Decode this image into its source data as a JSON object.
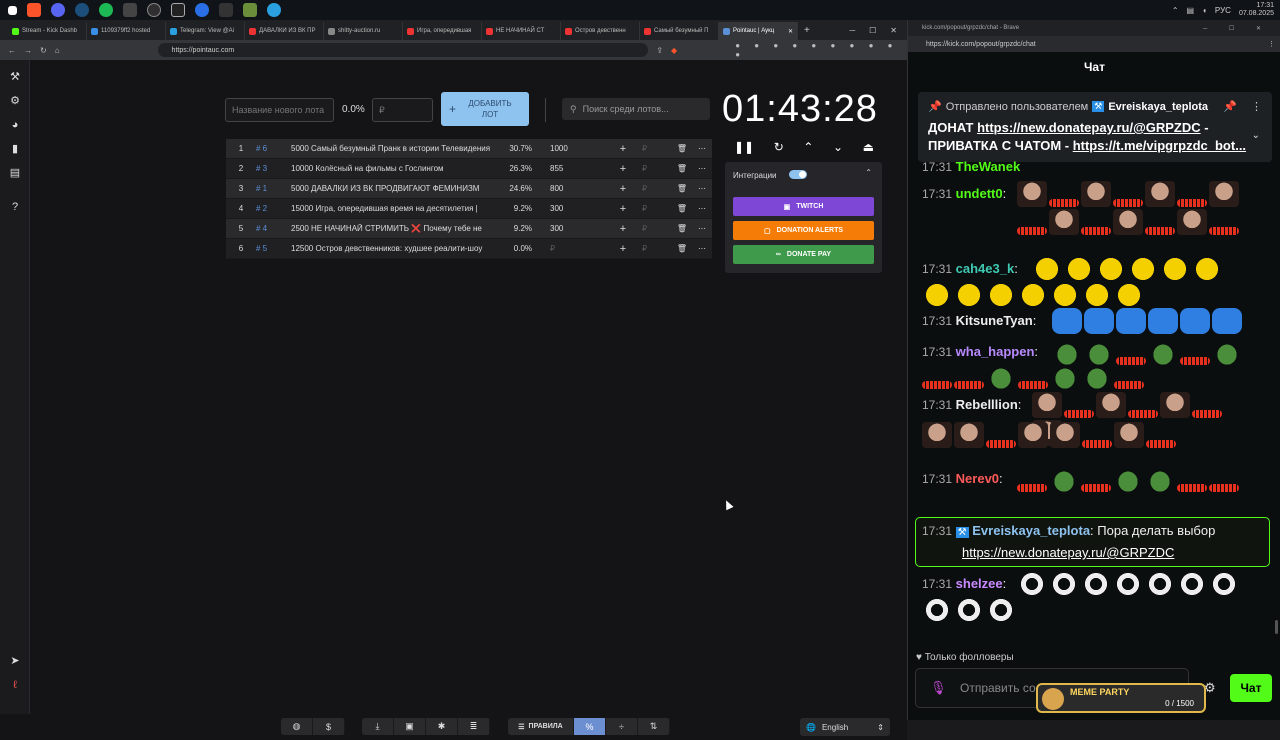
{
  "taskbar": {
    "lang": "РУС",
    "time": "17:31",
    "date": "07.08.2025"
  },
  "left_browser": {
    "tabs": [
      {
        "label": "Stream - Kick Dashb",
        "color": "#53fc18"
      },
      {
        "label": "1109379ff2 hosted",
        "color": "#3a8ee6"
      },
      {
        "label": "Telegram: View @Ai",
        "color": "#2aa0e0"
      },
      {
        "label": "ДАВАЛКИ ИЗ ВК ПР",
        "color": "#e33"
      },
      {
        "label": "shitty-auction.ru",
        "color": "#888"
      },
      {
        "label": "Игра, опередившая",
        "color": "#e33"
      },
      {
        "label": "НЕ НАЧИНАЙ СТ",
        "color": "#e33"
      },
      {
        "label": "Остров девственн",
        "color": "#e33"
      },
      {
        "label": "Самый безумный П",
        "color": "#e33"
      },
      {
        "label": "Pointauc | Аукц",
        "color": "#5b8fd6"
      }
    ],
    "url": "https://pointauc.com"
  },
  "app": {
    "new_lot_placeholder": "Название нового лота",
    "percent": "0.0%",
    "amount_placeholder": "₽",
    "add_lot_label": "ДОБАВИТЬ ЛОТ",
    "search_placeholder": "Поиск среди лотов...",
    "timer": "01:43:28",
    "lots": [
      {
        "n": "1",
        "id": "# 6",
        "name": "5000 Самый безумный Пранк в истории Телевидения",
        "pct": "30.7%",
        "amount": "1000"
      },
      {
        "n": "2",
        "id": "# 3",
        "name": "10000 Колёсный на фильмы с Гослингом",
        "pct": "26.3%",
        "amount": "855"
      },
      {
        "n": "3",
        "id": "# 1",
        "name": "5000 ДАВАЛКИ ИЗ ВК ПРОДВИГАЮТ ФЕМИНИЗМ",
        "pct": "24.6%",
        "amount": "800"
      },
      {
        "n": "4",
        "id": "# 2",
        "name": "15000 Игра, опередившая время на десятилетия |",
        "pct": "9.2%",
        "amount": "300"
      },
      {
        "n": "5",
        "id": "# 4",
        "name": "2500 НЕ НАЧИНАЙ СТРИМИТЬ ❌ Почему тебе не",
        "pct": "9.2%",
        "amount": "300"
      },
      {
        "n": "6",
        "id": "# 5",
        "name": "12500 Остров девственников: худшее реалити-шоу",
        "pct": "0.0%",
        "amount": ""
      }
    ],
    "row_currency": "₽",
    "integrations": {
      "label": "Интеграции",
      "twitch": "TWITCH",
      "donation_alerts": "DONATION ALERTS",
      "donate_pay": "DONATE PAY"
    },
    "bottom": {
      "rules": "ПРАВИЛА",
      "language": "English"
    }
  },
  "right_browser": {
    "title": "kick.com/popout/grpzdc/chat - Brave",
    "url": "https://kick.com/popout/grpzdc/chat",
    "chat_title": "Чат",
    "pinned": {
      "prefix": "Отправлено пользователем",
      "user": "Evreiskaya_teplota",
      "line1_text": "ДОНАТ ",
      "line1_link": "https://new.donatepay.ru/@GRPZDC",
      "line1_suffix": " -",
      "line2_text": "ПРИВАТКА С ЧАТОМ - ",
      "line2_link": "https://t.me/vipgrpzdc_bot..."
    },
    "messages": [
      {
        "time": "17:31",
        "user": "TheWanek",
        "color": "#53fc18"
      },
      {
        "time": "17:31",
        "user": "undett0",
        "color": "#53fc18"
      },
      {
        "time": "17:31",
        "user": "cah4e3_k",
        "color": "#3fc9b2"
      },
      {
        "time": "17:31",
        "user": "KitsuneTyan",
        "color": "#eee"
      },
      {
        "time": "17:31",
        "user": "wha_happen",
        "color": "#b98aff"
      },
      {
        "time": "17:31",
        "user": "Rebelllion",
        "color": "#eee"
      },
      {
        "time": "17:31",
        "user": "Nerev0",
        "color": "#ff5a5a"
      },
      {
        "time": "17:31",
        "user": "Evreiskaya_teplota",
        "color": "#8ec3f0",
        "text": "Пора делать выбор",
        "link": "https://new.donatepay.ru/@GRPZDC"
      },
      {
        "time": "17:31",
        "user": "shelzee",
        "color": "#c98aff"
      }
    ],
    "followers_only": "Только фолловеры",
    "input_placeholder": "Отправить со",
    "send_label": "Чат",
    "meme_party": {
      "title": "MEME PARTY",
      "count": "0 / 1500"
    }
  }
}
